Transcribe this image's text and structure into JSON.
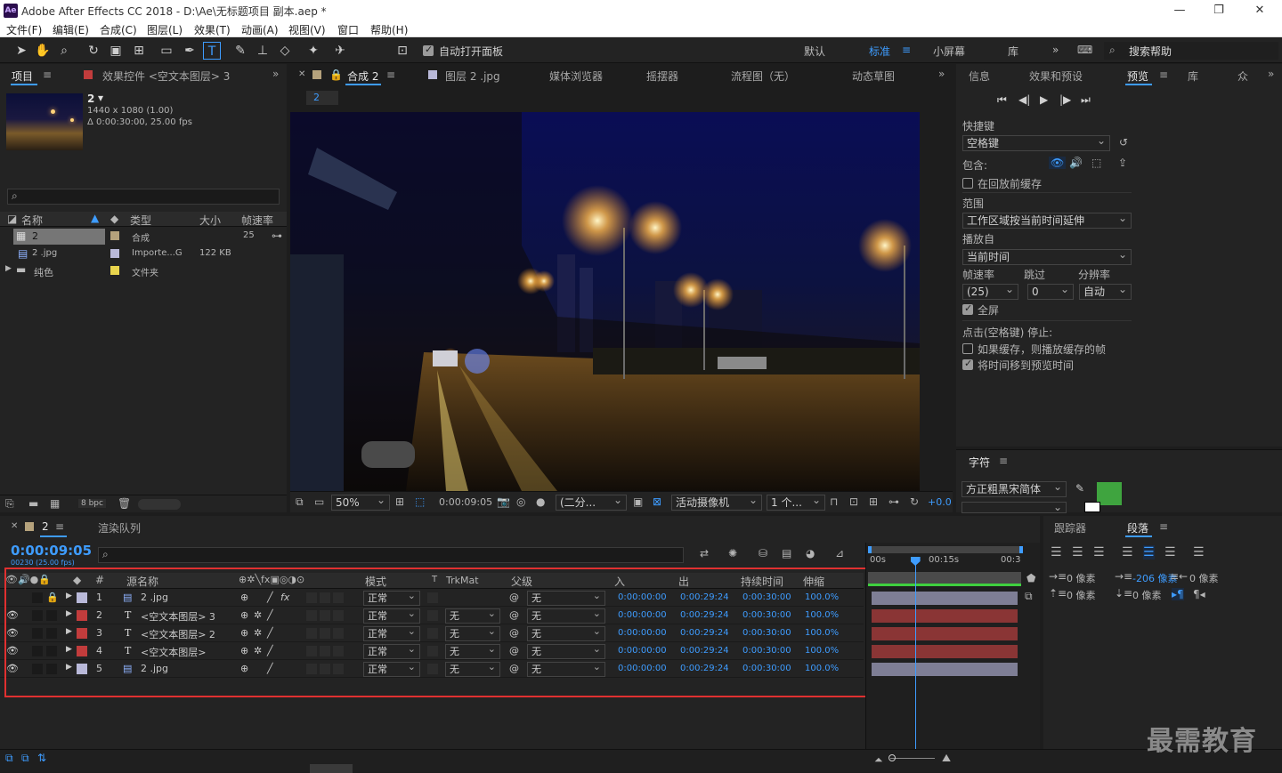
{
  "app": {
    "title": "Adobe After Effects CC 2018 - D:\\Ae\\无标题项目 副本.aep *",
    "logo": "Ae"
  },
  "menu": [
    "文件(F)",
    "编辑(E)",
    "合成(C)",
    "图层(L)",
    "效果(T)",
    "动画(A)",
    "视图(V)",
    "窗口",
    "帮助(H)"
  ],
  "toolbar": {
    "auto_open": "自动打开面板",
    "workspaces": [
      "默认",
      "标准",
      "小屏幕",
      "库"
    ],
    "active_ws": "标准",
    "search": "搜索帮助"
  },
  "project": {
    "tab": "项目",
    "fx_tab": "效果控件 <空文本图层> 3",
    "comp_name": "2",
    "comp_info1": "1440 x 1080 (1.00)",
    "comp_info2": "Δ 0:00:30:00, 25.00 fps",
    "columns": [
      "名称",
      "类型",
      "大小",
      "帧速率"
    ],
    "items": [
      {
        "name": "2",
        "type": "合成",
        "size": "",
        "fps": "25",
        "color": "#b5a27c"
      },
      {
        "name": "2 .jpg",
        "type": "Importe...G",
        "size": "122 KB",
        "fps": "",
        "color": "#b9b9d9"
      },
      {
        "name": "纯色",
        "type": "文件夹",
        "size": "",
        "fps": "",
        "color": "#e8d44d"
      }
    ],
    "bpc": "8 bpc"
  },
  "comp": {
    "tab": "合成 2",
    "layer_tab": "图层 2 .jpg",
    "media": "媒体浏览器",
    "wiggler": "摇摆器",
    "flow": "流程图（无）",
    "motion": "动态草图",
    "chip": "2",
    "zoom": "50%",
    "timecode": "0:00:09:05",
    "res": "(二分...",
    "camera": "活动摄像机",
    "views": "1 个...",
    "exposure": "+0.0"
  },
  "preview": {
    "tabs": [
      "信息",
      "效果和预设",
      "预览",
      "库"
    ],
    "active": "预览",
    "shortcut_label": "快捷键",
    "shortcut": "空格键",
    "include": "包含:",
    "cache_before": "在回放前缓存",
    "range_label": "范围",
    "range": "工作区域按当前时间延伸",
    "play_from_label": "播放自",
    "play_from": "当前时间",
    "fps_label": "帧速率",
    "skip_label": "跳过",
    "res_label": "分辨率",
    "fps": "(25)",
    "skip": "0",
    "res": "自动",
    "fullscreen": "全屏",
    "stop_label": "点击(空格键) 停止:",
    "cache_if": "如果缓存，则播放缓存的帧",
    "move_time": "将时间移到预览时间"
  },
  "character": {
    "tab": "字符",
    "font": "方正粗黑宋简体",
    "fill": "#3fa43f"
  },
  "paragraph": {
    "tabs": [
      "跟踪器",
      "段落"
    ],
    "active": "段落",
    "v0": "0 像素",
    "v1": "-206 像素",
    "v2": "0 像素",
    "v3": "0 像素",
    "v4": "0 像素"
  },
  "timeline": {
    "tab": "2",
    "render_tab": "渲染队列",
    "timecode": "0:00:09:05",
    "frames": "00230 (25.00 fps)",
    "headers": {
      "num": "#",
      "source": "源名称",
      "mode": "模式",
      "t": "T",
      "trkmat": "TrkMat",
      "parent": "父级",
      "in": "入",
      "out": "出",
      "dur": "持续时间",
      "stretch": "伸缩"
    },
    "ruler": [
      "00s",
      "00:15s",
      "00:3"
    ],
    "layers": [
      {
        "num": "1",
        "name": "2 .jpg",
        "type": "img",
        "color": "#b9b9d9",
        "mode": "正常",
        "trk": "",
        "parent": "无",
        "in": "0:00:00:00",
        "out": "0:00:29:24",
        "dur": "0:00:30:00",
        "stretch": "100.0%",
        "bar": "#7e7e95"
      },
      {
        "num": "2",
        "name": "<空文本图层> 3",
        "type": "T",
        "color": "#c23c3c",
        "mode": "正常",
        "trk": "无",
        "parent": "无",
        "in": "0:00:00:00",
        "out": "0:00:29:24",
        "dur": "0:00:30:00",
        "stretch": "100.0%",
        "bar": "#8a3535"
      },
      {
        "num": "3",
        "name": "<空文本图层> 2",
        "type": "T",
        "color": "#c23c3c",
        "mode": "正常",
        "trk": "无",
        "parent": "无",
        "in": "0:00:00:00",
        "out": "0:00:29:24",
        "dur": "0:00:30:00",
        "stretch": "100.0%",
        "bar": "#8a3535"
      },
      {
        "num": "4",
        "name": "<空文本图层>",
        "type": "T",
        "color": "#c23c3c",
        "mode": "正常",
        "trk": "无",
        "parent": "无",
        "in": "0:00:00:00",
        "out": "0:00:29:24",
        "dur": "0:00:30:00",
        "stretch": "100.0%",
        "bar": "#8a3535"
      },
      {
        "num": "5",
        "name": "2 .jpg",
        "type": "img",
        "color": "#b9b9d9",
        "mode": "正常",
        "trk": "无",
        "parent": "无",
        "in": "0:00:00:00",
        "out": "0:00:29:24",
        "dur": "0:00:30:00",
        "stretch": "100.0%",
        "bar": "#7e7e95"
      }
    ],
    "playhead": 0.306
  },
  "watermark": "最需教育",
  "colors": {
    "accent": "#3e9cff",
    "highlight": "#e03030"
  }
}
